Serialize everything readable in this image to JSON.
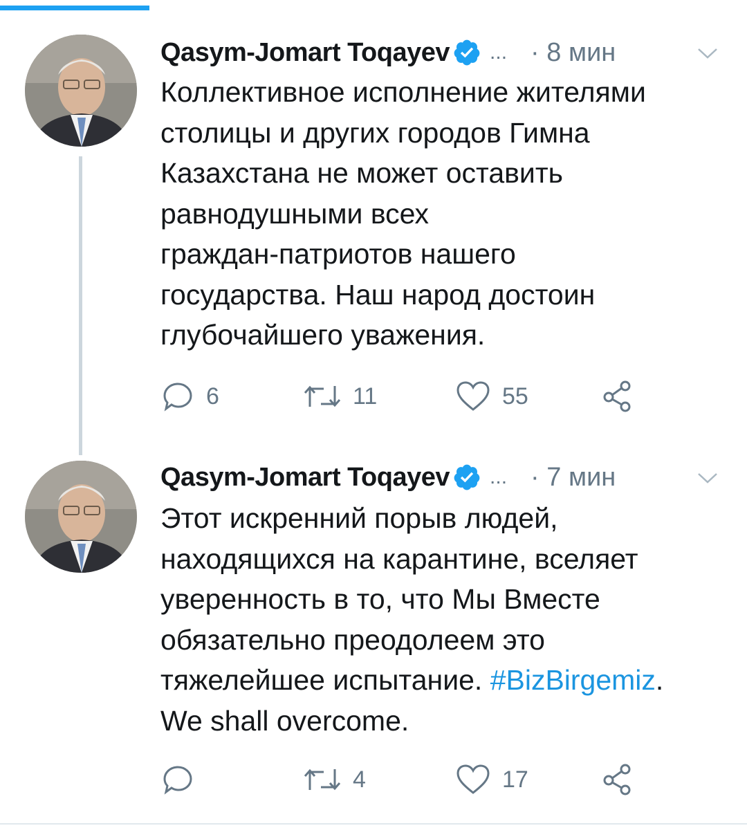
{
  "colors": {
    "accent": "#1da1f2",
    "hashtag": "#1b95e0",
    "muted": "#657786",
    "text": "#14171a",
    "thread_line": "#ccd6dd"
  },
  "tweets": [
    {
      "author": "Qasym-Jomart Toqayev",
      "more": "...",
      "time": "· 8 мин",
      "text": "Коллективное исполнение жителями\nстолицы и других городов Гимна\nКазахстана не может оставить\nравнодушными всех\nграждан-патриотов нашего\nгосударства. Наш народ достоин\nглубочайшего уважения.",
      "replies": "6",
      "retweets": "11",
      "likes": "55",
      "icons": [
        "reply-icon",
        "retweet-icon",
        "like-icon",
        "share-icon"
      ]
    },
    {
      "author": "Qasym-Jomart Toqayev",
      "more": "...",
      "time": "· 7 мин",
      "text_before": "Этот искренний порыв людей,\nнаходящихся на карантине, вселяет\nуверенность в то, что Мы Вместе\nобязательно преодолеем это\nтяжелейшее испытание. ",
      "hashtag": "#BizBirgemiz",
      "text_after": ".\nWe shall overcome.",
      "replies": "",
      "retweets": "4",
      "likes": "17",
      "icons": [
        "reply-icon",
        "retweet-icon",
        "like-icon",
        "share-icon"
      ]
    }
  ]
}
